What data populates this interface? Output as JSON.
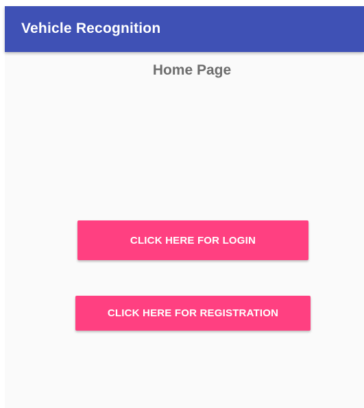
{
  "app_bar": {
    "title": "Vehicle Recognition",
    "color": "#3f51b5"
  },
  "main": {
    "heading": "Home Page",
    "login_button_label": "CLICK HERE FOR LOGIN",
    "registration_button_label": "CLICK HERE FOR REGISTRATION",
    "accent_color": "#ff4081"
  }
}
